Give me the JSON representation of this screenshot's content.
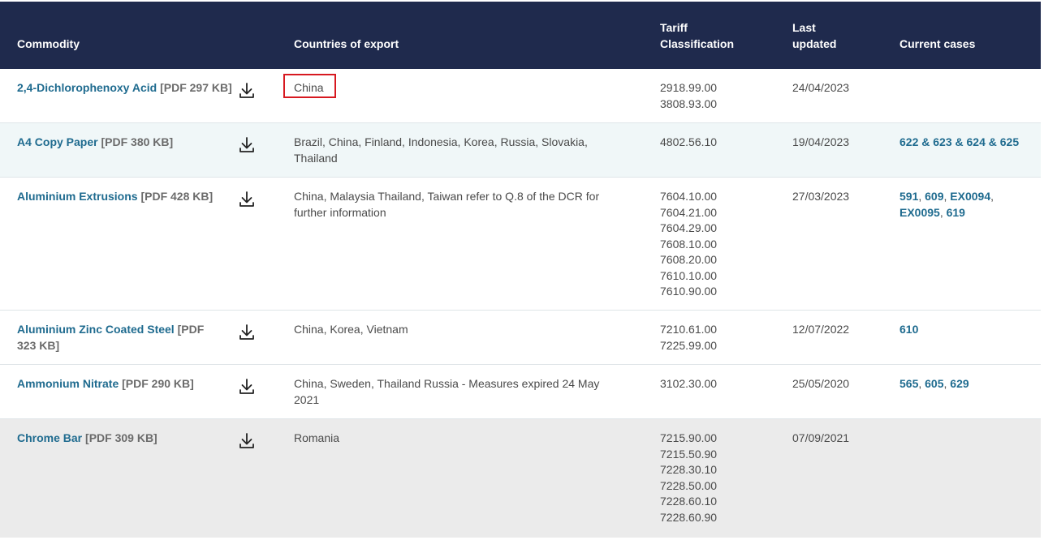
{
  "header": {
    "commodity": "Commodity",
    "countries": "Countries of export",
    "tariff_line1": "Tariff",
    "tariff_line2": "Classification",
    "updated_line1": "Last",
    "updated_line2": "updated",
    "cases": "Current cases"
  },
  "rows": [
    {
      "name": "2,4-Dichlorophenoxy Acid",
      "pdf": "[PDF 297 KB]",
      "countries": "China",
      "codes": [
        "2918.99.00",
        "3808.93.00"
      ],
      "updated": "24/04/2023",
      "cases": []
    },
    {
      "name": "A4 Copy Paper",
      "pdf": "[PDF 380 KB]",
      "countries": "Brazil, China, Finland, Indonesia, Korea, Russia, Slovakia, Thailand",
      "codes": [
        "4802.56.10"
      ],
      "updated": "19/04/2023",
      "cases_text": "622 & 623 & 624 & 625"
    },
    {
      "name": "Aluminium Extrusions",
      "pdf": "[PDF 428 KB]",
      "countries": "China, Malaysia Thailand, Taiwan refer to Q.8 of the DCR for further information",
      "codes": [
        "7604.10.00",
        "7604.21.00",
        "7604.29.00",
        "7608.10.00",
        "7608.20.00",
        "7610.10.00",
        "7610.90.00"
      ],
      "updated": "27/03/2023",
      "cases": [
        "591",
        "609",
        "EX0094",
        "EX0095",
        "619"
      ]
    },
    {
      "name": "Aluminium Zinc Coated Steel",
      "pdf": "[PDF 323 KB]",
      "countries": "China, Korea, Vietnam",
      "codes": [
        "7210.61.00",
        "7225.99.00"
      ],
      "updated": "12/07/2022",
      "cases": [
        "610"
      ]
    },
    {
      "name": "Ammonium Nitrate",
      "pdf": "[PDF 290 KB]",
      "countries": "China, Sweden, Thailand Russia - Measures expired 24 May 2021",
      "codes": [
        "3102.30.00"
      ],
      "updated": "25/05/2020",
      "cases": [
        "565",
        "605",
        "629"
      ]
    },
    {
      "name": "Chrome Bar",
      "pdf": "[PDF 309 KB]",
      "countries": "Romania",
      "codes": [
        "7215.90.00",
        "7215.50.90",
        "7228.30.10",
        "7228.50.00",
        "7228.60.10",
        "7228.60.90"
      ],
      "updated": "07/09/2021",
      "cases": []
    }
  ],
  "icons": {
    "download": "download-icon"
  },
  "colors": {
    "header_bg": "#1f2a4d",
    "link": "#1f6b8f",
    "highlight": "#d71920",
    "row_alt": "#f0f7f8",
    "row_hover": "#ebebeb"
  }
}
